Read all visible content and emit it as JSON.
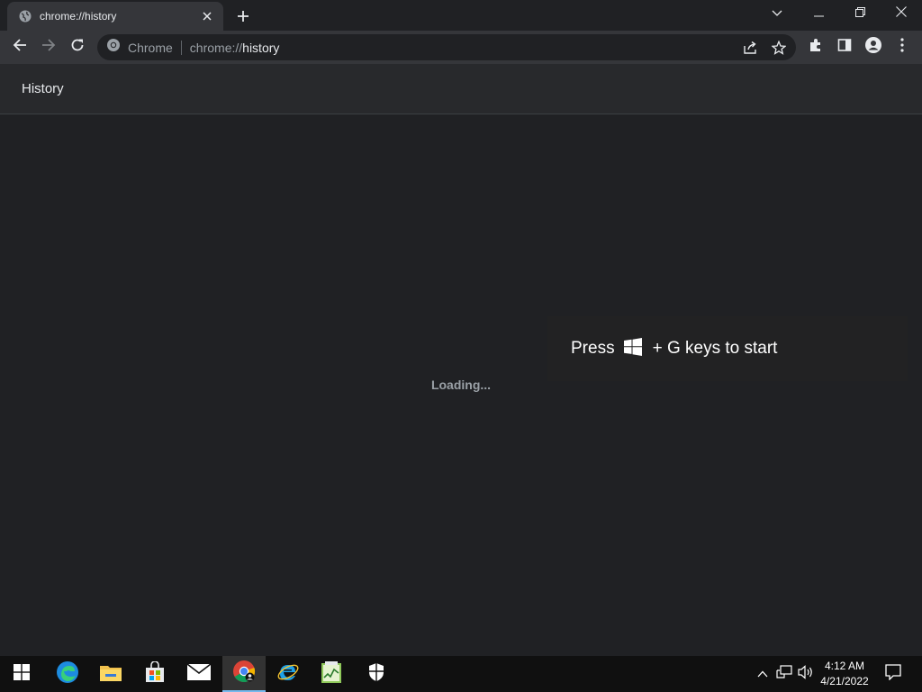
{
  "browser": {
    "tab": {
      "title": "chrome://history"
    },
    "omnibox": {
      "chip": "Chrome",
      "url_scheme": "chrome://",
      "url_host": "history"
    }
  },
  "page": {
    "title": "History",
    "status": "Loading..."
  },
  "game_bar_toast": {
    "prefix": "Press",
    "suffix": "+ G keys to start"
  },
  "taskbar": {
    "apps": [
      "start",
      "edge",
      "file-explorer",
      "store",
      "mail",
      "chrome",
      "internet-explorer",
      "task-manager",
      "security"
    ],
    "clock": {
      "time": "4:12 AM",
      "date": "4/21/2022"
    }
  },
  "colors": {
    "background": "#202124",
    "toolbar": "#35363a",
    "accent": "#8ab4f8",
    "taskbar": "#101010"
  }
}
